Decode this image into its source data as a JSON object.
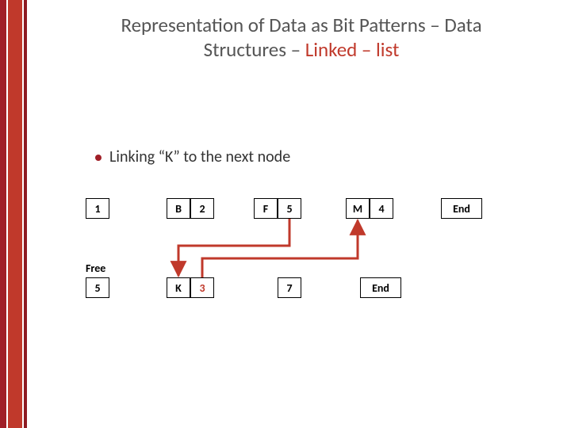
{
  "title": {
    "line1a": "Representation of Data as Bit Patterns – Data",
    "line2a": "Structures – ",
    "line2b": "Linked – list"
  },
  "bullet": "Linking “K” to the next node",
  "row1": {
    "head": "1",
    "n1": {
      "val": "B",
      "ptr": "2"
    },
    "n2": {
      "val": "F",
      "ptr": "5"
    },
    "n3": {
      "val": "M",
      "ptr": "4"
    },
    "end": "End"
  },
  "free_label": "Free",
  "row2": {
    "head": "5",
    "n1": {
      "val": "K",
      "ptr": "3"
    },
    "n2": {
      "ptr": "7"
    },
    "end": "End"
  },
  "colors": {
    "accent": "#c0392b",
    "dark": "#a01f27",
    "arrow": "#c0392b",
    "highlight_ptr": "#c0392b"
  }
}
